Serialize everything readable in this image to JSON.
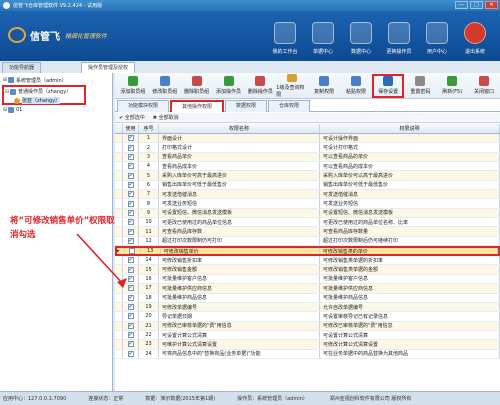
{
  "window": {
    "title": "信管飞仓库管理软件 V9.2.424 - 试用版",
    "buttons": {
      "minimize": "—",
      "maximize": "□",
      "close": "✕"
    }
  },
  "brand": {
    "name": "信管飞",
    "slogan": "精细化管理软件"
  },
  "nav": [
    {
      "label": "我的工作台",
      "icon": "desktop-icon"
    },
    {
      "label": "单据中心",
      "icon": "documents-icon"
    },
    {
      "label": "数据中心",
      "icon": "data-icon"
    },
    {
      "label": "更换操作员",
      "icon": "user-switch-icon"
    },
    {
      "label": "用户中心",
      "icon": "user-center-icon"
    },
    {
      "label": "退出系统",
      "icon": "exit-icon"
    }
  ],
  "left_tabs": [
    "功能导航器",
    "操作员管理及授权"
  ],
  "tree": [
    {
      "label": "系统管理员（admin）",
      "indent": 0,
      "toggle": "⊞"
    },
    {
      "label": "普通操作员（zhangy）",
      "indent": 0,
      "toggle": "⊟"
    },
    {
      "label": "张亚（zhangy）",
      "indent": 1,
      "toggle": ""
    },
    {
      "label": "01",
      "indent": 0,
      "toggle": "⊞"
    }
  ],
  "toolbar": [
    {
      "label": "添加职员组",
      "color": "#3a9a3a",
      "highlight": false
    },
    {
      "label": "修改职员组",
      "color": "#4a80c8",
      "highlight": false
    },
    {
      "label": "删除职员组",
      "color": "#c84a4a",
      "highlight": false
    },
    {
      "label": "添加操作员",
      "color": "#3a9a3a",
      "highlight": false
    },
    {
      "label": "删除操作员",
      "color": "#c84a4a",
      "highlight": false
    },
    {
      "label": "1级及查询权限",
      "color": "#d9a030",
      "highlight": false
    },
    {
      "label": "复制权限",
      "color": "#4a80c8",
      "highlight": false
    },
    {
      "label": "粘贴权限",
      "color": "#4a80c8",
      "highlight": false
    },
    {
      "label": "保存设置",
      "color": "#2a6db5",
      "highlight": true
    },
    {
      "label": "重置密码",
      "color": "#8a8a8a",
      "highlight": false
    },
    {
      "label": "刷新(F5)",
      "color": "#3a9a3a",
      "highlight": false
    },
    {
      "label": "关闭窗口",
      "color": "#c84a4a",
      "highlight": false
    }
  ],
  "subtabs": [
    "功能模块权限",
    "其他操作权限",
    "数据权限",
    "仓库权限"
  ],
  "active_subtab": 1,
  "select_all": "全部选中",
  "deselect_all": "全部取消",
  "grid": {
    "headers": [
      "使用",
      "序号",
      "权限名称",
      "权限说明"
    ],
    "rows": [
      {
        "checked": true,
        "no": "1",
        "name": "界面设计",
        "desc": "可设计操作界面"
      },
      {
        "checked": true,
        "no": "2",
        "name": "打印格式设计",
        "desc": "可设计打印格式"
      },
      {
        "checked": true,
        "no": "3",
        "name": "查看商品单价",
        "desc": "可以查看商品的单价"
      },
      {
        "checked": true,
        "no": "4",
        "name": "查看商品成本价",
        "desc": "可以查看商品的成本价"
      },
      {
        "checked": true,
        "no": "5",
        "name": "采购入库单价可高于最高进价",
        "desc": "采购入库单价可以高于最高进价"
      },
      {
        "checked": true,
        "no": "6",
        "name": "销售出库单价可低于最低售价",
        "desc": "销售出库单价可低于最低售价"
      },
      {
        "checked": true,
        "no": "7",
        "name": "可发送借催消息",
        "desc": "可发送借催消息"
      },
      {
        "checked": true,
        "no": "8",
        "name": "可发送业务短信",
        "desc": "可发送业务短信"
      },
      {
        "checked": true,
        "no": "9",
        "name": "可设置短信、微信消息发送模板",
        "desc": "可设置短信、微信消息发送模板"
      },
      {
        "checked": true,
        "no": "10",
        "name": "可更改已使用过的商品单位信息",
        "desc": "可更改已使用过的商品单位名称、比率"
      },
      {
        "checked": true,
        "no": "11",
        "name": "可查看商品库存数",
        "desc": "可查看商品库存数量"
      },
      {
        "checked": true,
        "no": "12",
        "name": "超过打印次数限制仍可打印",
        "desc": "超过打印次数限制后仍可继续打印"
      },
      {
        "checked": false,
        "no": "13",
        "name": "可修改销售单价",
        "desc": "可修改销售类的单价",
        "selected": true
      },
      {
        "checked": true,
        "no": "14",
        "name": "可修改销售折扣率",
        "desc": "可修改销售类单据的折扣率"
      },
      {
        "checked": true,
        "no": "15",
        "name": "可修改销售金额",
        "desc": "可修改销售类单据的金额"
      },
      {
        "checked": true,
        "no": "16",
        "name": "可批量维护客户信息",
        "desc": "可批量维护客户信息"
      },
      {
        "checked": true,
        "no": "17",
        "name": "可批量维护供应商信息",
        "desc": "可批量维护供应商信息"
      },
      {
        "checked": true,
        "no": "18",
        "name": "可批量维护商品信息",
        "desc": "可批量维护商品信息"
      },
      {
        "checked": true,
        "no": "19",
        "name": "可修改单据编号",
        "desc": "允许自改单据编号"
      },
      {
        "checked": true,
        "no": "20",
        "name": "导记单据日期",
        "desc": "可设置审核导记已有记录信息"
      },
      {
        "checked": true,
        "no": "21",
        "name": "可修改已审核单据的\"费\"用信息",
        "desc": "可修改已审核单据的\"费\"用信息"
      },
      {
        "checked": true,
        "no": "22",
        "name": "可设置计算公式清算",
        "desc": "可设置计算公式清算"
      },
      {
        "checked": true,
        "no": "23",
        "name": "可维护计算公式清算设置",
        "desc": "可修改计算公式清算设置"
      },
      {
        "checked": true,
        "no": "24",
        "name": "可将商品信息中的\"替换商品(业务单据)\"功能",
        "desc": "可在业务单据中的商品替换为其他商品"
      }
    ]
  },
  "annotation": "将“可修改销售单价”权限取消勾选",
  "status": [
    "应用中心：127.0.0.1:7090",
    "连接状态：正常",
    "数据：演示数据(2015年第1期)",
    "操作员：系统管理员（admin）",
    "郑州亚视创科软件有限公司  版权所有"
  ],
  "colors": {
    "accent_red": "#e0242b",
    "banner_blue": "#1c63b0",
    "row_yellow": "#fdf8e6"
  }
}
